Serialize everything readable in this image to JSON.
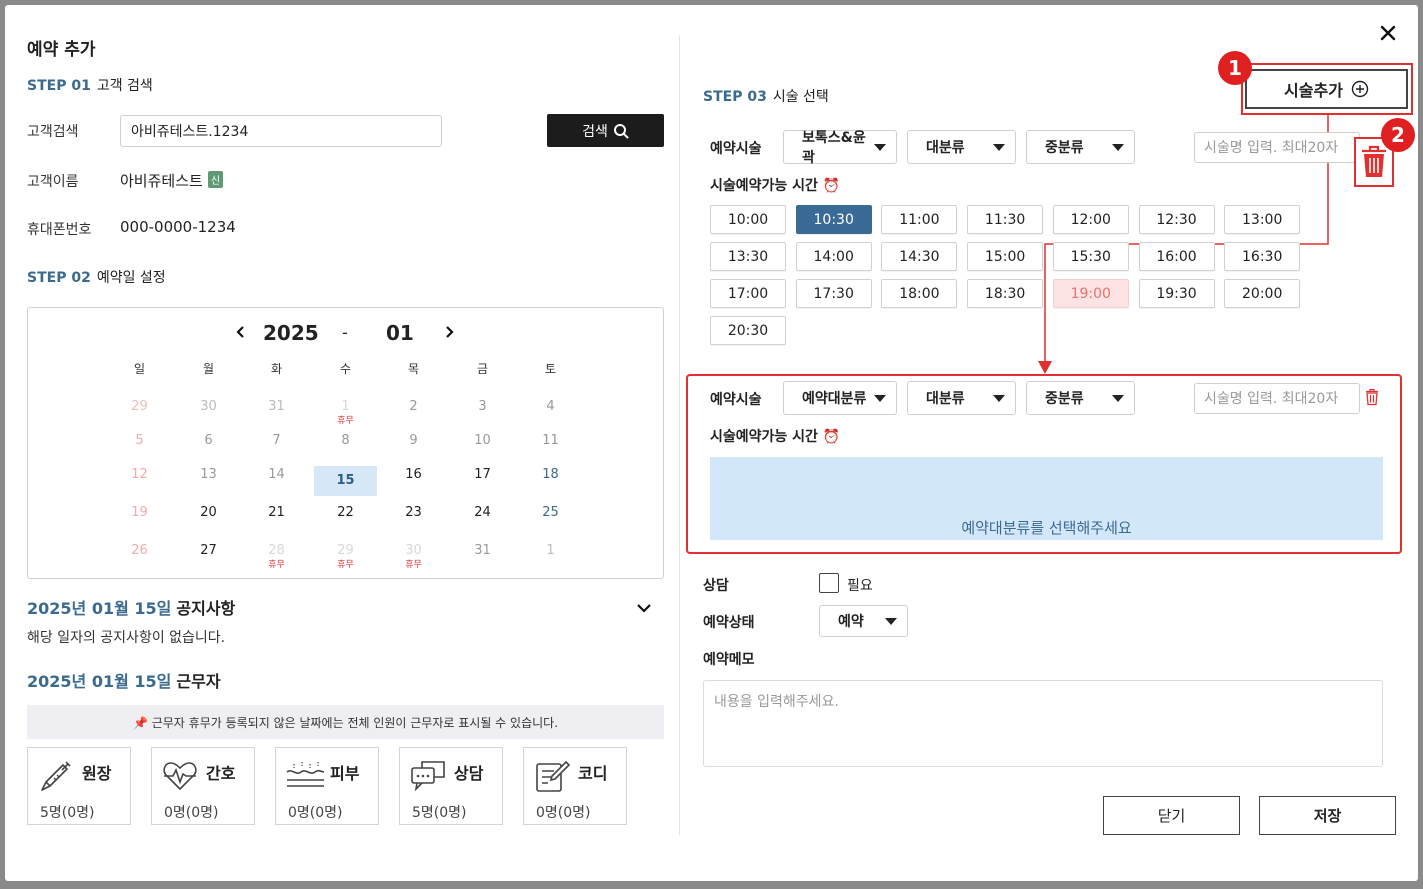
{
  "title": "예약 추가",
  "step1": {
    "no": "STEP 01",
    "label": "고객 검색"
  },
  "search": {
    "label": "고객검색",
    "value": "아비쥬테스트.1234",
    "button": "검색"
  },
  "customer": {
    "name_label": "고객이름",
    "name": "아비쥬테스트",
    "badge": "신",
    "phone_label": "휴대폰번호",
    "phone": "000-0000-1234"
  },
  "step2": {
    "no": "STEP 02",
    "label": "예약일 설정"
  },
  "calendar": {
    "year": "2025",
    "dash": "-",
    "month": "01",
    "weekdays": [
      "일",
      "월",
      "화",
      "수",
      "목",
      "금",
      "토"
    ],
    "holiday_label": "휴무",
    "weeks": [
      [
        {
          "d": "29",
          "o": true
        },
        {
          "d": "30",
          "o": true
        },
        {
          "d": "31",
          "o": true
        },
        {
          "d": "1",
          "hol": true
        },
        {
          "d": "2",
          "p": true
        },
        {
          "d": "3",
          "p": true
        },
        {
          "d": "4",
          "p": true
        }
      ],
      [
        {
          "d": "5",
          "p": true
        },
        {
          "d": "6",
          "p": true
        },
        {
          "d": "7",
          "p": true
        },
        {
          "d": "8",
          "p": true
        },
        {
          "d": "9",
          "p": true
        },
        {
          "d": "10",
          "p": true
        },
        {
          "d": "11",
          "p": true
        }
      ],
      [
        {
          "d": "12",
          "p": true
        },
        {
          "d": "13",
          "p": true
        },
        {
          "d": "14",
          "p": true
        },
        {
          "d": "15",
          "sel": true
        },
        {
          "d": "16"
        },
        {
          "d": "17"
        },
        {
          "d": "18"
        }
      ],
      [
        {
          "d": "19"
        },
        {
          "d": "20"
        },
        {
          "d": "21"
        },
        {
          "d": "22"
        },
        {
          "d": "23"
        },
        {
          "d": "24"
        },
        {
          "d": "25"
        }
      ],
      [
        {
          "d": "26"
        },
        {
          "d": "27"
        },
        {
          "d": "28",
          "hol": true
        },
        {
          "d": "29",
          "hol": true
        },
        {
          "d": "30",
          "hol": true
        },
        {
          "d": "31",
          "p": true
        },
        {
          "d": "1",
          "o": true
        }
      ]
    ]
  },
  "notice": {
    "date": "2025년 01월 15일",
    "title": "공지사항",
    "body": "해당 일자의 공지사항이 없습니다."
  },
  "staff_section": {
    "date": "2025년 01월 15일",
    "title": "근무자",
    "note": "📌 근무자 휴무가 등록되지 않은 날짜에는 전체 인원이 근무자로 표시될 수 있습니다."
  },
  "staff": [
    {
      "name": "원장",
      "count": "5명(0명)",
      "icon": "syringe-icon"
    },
    {
      "name": "간호",
      "count": "0명(0명)",
      "icon": "heartbeat-icon"
    },
    {
      "name": "피부",
      "count": "0명(0명)",
      "icon": "skin-icon"
    },
    {
      "name": "상담",
      "count": "5명(0명)",
      "icon": "chat-bubbles-icon"
    },
    {
      "name": "코디",
      "count": "0명(0명)",
      "icon": "edit-note-icon"
    }
  ],
  "step3": {
    "no": "STEP 03",
    "label": "시술 선택"
  },
  "add_button": "시술추가",
  "callouts": [
    "1",
    "2"
  ],
  "procedure1": {
    "label": "예약시술",
    "cat": "보톡스&윤곽",
    "major": "대분류",
    "mid": "중분류",
    "placeholder": "시술명 입력. 최대20자",
    "time_label": "시술예약가능 시간 ⏰",
    "slots": [
      "10:00",
      "10:30",
      "11:00",
      "11:30",
      "12:00",
      "12:30",
      "13:00",
      "13:30",
      "14:00",
      "14:30",
      "15:00",
      "15:30",
      "16:00",
      "16:30",
      "17:00",
      "17:30",
      "18:00",
      "18:30",
      "19:00",
      "19:30",
      "20:00",
      "20:30"
    ],
    "active_slot": "10:30",
    "disabled_slot": "19:00"
  },
  "procedure2": {
    "label": "예약시술",
    "cat": "예약대분류",
    "major": "대분류",
    "mid": "중분류",
    "placeholder": "시술명 입력. 최대20자",
    "time_label": "시술예약가능 시간 ⏰",
    "empty_msg": "예약대분류를 선택해주세요"
  },
  "consult": {
    "label": "상담",
    "option": "필요"
  },
  "status": {
    "label": "예약상태",
    "value": "예약"
  },
  "memo": {
    "label": "예약메모",
    "placeholder": "내용을 입력해주세요."
  },
  "footer": {
    "close": "닫기",
    "save": "저장"
  },
  "colors": {
    "accent": "#3b6a8f",
    "highlight_red": "#e03030",
    "active_slot": "#3a6a96"
  }
}
